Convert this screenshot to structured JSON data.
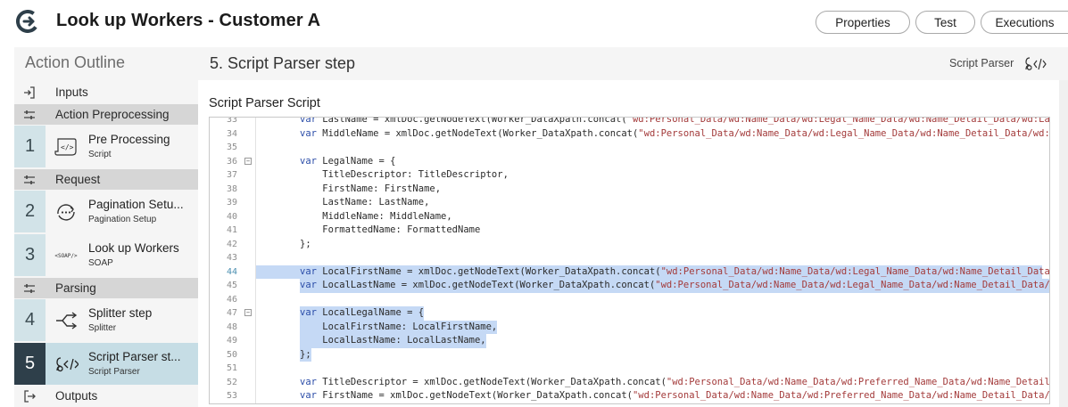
{
  "header": {
    "title": "Look up Workers - Customer A",
    "buttons": {
      "properties": "Properties",
      "test": "Test",
      "executions": "Executions"
    }
  },
  "sidebar": {
    "heading": "Action Outline",
    "inputs_label": "Inputs",
    "outputs_label": "Outputs",
    "sections": {
      "preprocessing": "Action Preprocessing",
      "request": "Request",
      "parsing": "Parsing"
    },
    "steps": [
      {
        "num": "1",
        "title": "Pre Processing",
        "sub": "Script",
        "icon": "script-icon"
      },
      {
        "num": "2",
        "title": "Pagination Setu...",
        "sub": "Pagination Setup",
        "icon": "pagination-icon"
      },
      {
        "num": "3",
        "title": "Look up Workers",
        "sub": "SOAP",
        "icon": "soap-icon",
        "icon_text": "<SOAP/>"
      },
      {
        "num": "4",
        "title": "Splitter step",
        "sub": "Splitter",
        "icon": "splitter-icon"
      },
      {
        "num": "5",
        "title": "Script Parser st...",
        "sub": "Script Parser",
        "icon": "script-parser-icon"
      }
    ]
  },
  "main": {
    "title": "5.  Script Parser step",
    "type_label": "Script Parser",
    "script_label": "Script Parser Script"
  },
  "code": {
    "lines": [
      {
        "n": "33",
        "text": "var LastName = xmlDoc.getNodeText(Worker_DataXpath.concat(\"wd:Personal_Data/wd:Name_Data/wd:Legal_Name_Data/wd:Name_Detail_Data/wd:Last_N"
      },
      {
        "n": "34",
        "text": "var MiddleName = xmlDoc.getNodeText(Worker_DataXpath.concat(\"wd:Personal_Data/wd:Name_Data/wd:Legal_Name_Data/wd:Name_Detail_Data/wd:Midd"
      },
      {
        "n": "35",
        "text": ""
      },
      {
        "n": "36",
        "text": "var LegalName = {"
      },
      {
        "n": "37",
        "text": "    TitleDescriptor: TitleDescriptor,"
      },
      {
        "n": "38",
        "text": "    FirstName: FirstName,"
      },
      {
        "n": "39",
        "text": "    LastName: LastName,"
      },
      {
        "n": "40",
        "text": "    MiddleName: MiddleName,"
      },
      {
        "n": "41",
        "text": "    FormattedName: FormattedName"
      },
      {
        "n": "42",
        "text": "};"
      },
      {
        "n": "43",
        "text": ""
      },
      {
        "n": "44",
        "text": "var LocalFirstName = xmlDoc.getNodeText(Worker_DataXpath.concat(\"wd:Personal_Data/wd:Name_Data/wd:Legal_Name_Data/wd:Name_Detail_Data/wd:"
      },
      {
        "n": "45",
        "text": "var LocalLastName = xmlDoc.getNodeText(Worker_DataXpath.concat(\"wd:Personal_Data/wd:Name_Data/wd:Legal_Name_Data/wd:Name_Detail_Data/wd:L"
      },
      {
        "n": "46",
        "text": ""
      },
      {
        "n": "47",
        "text": "var LocalLegalName = {"
      },
      {
        "n": "48",
        "text": "    LocalFirstName: LocalFirstName,"
      },
      {
        "n": "49",
        "text": "    LocalLastName: LocalLastName,"
      },
      {
        "n": "50",
        "text": "};"
      },
      {
        "n": "51",
        "text": ""
      },
      {
        "n": "52",
        "text": "var TitleDescriptor = xmlDoc.getNodeText(Worker_DataXpath.concat(\"wd:Personal_Data/wd:Name_Data/wd:Preferred_Name_Data/wd:Name_Detail_Dat"
      },
      {
        "n": "53",
        "text": "var FirstName = xmlDoc.getNodeText(Worker_DataXpath.concat(\"wd:Personal_Data/wd:Name_Data/wd:Preferred_Name_Data/wd:Name_Detail_Data/wd:F"
      }
    ]
  },
  "colors": {
    "accent": "#2e3f4a",
    "step_bg": "#d2e3e8",
    "active_step_bg": "#c6dde5",
    "selection": "#c5d9f5",
    "section_bg": "#d6d6d6"
  }
}
